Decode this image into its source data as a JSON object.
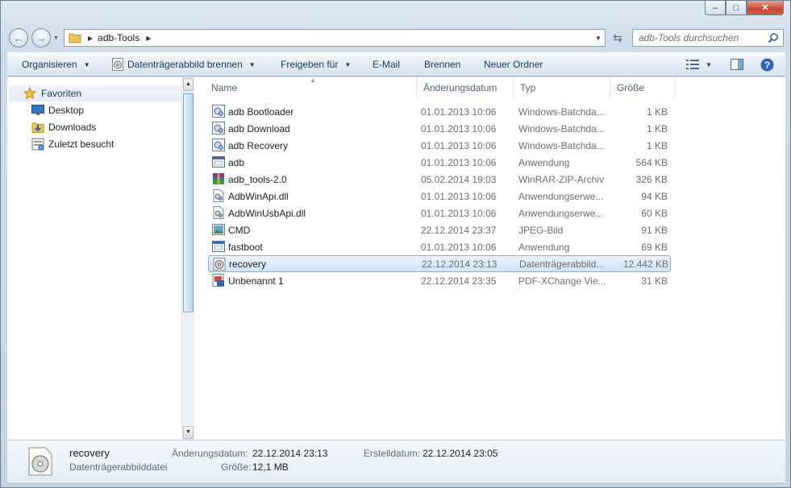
{
  "window": {
    "title_buttons": {
      "minimize": "–",
      "maximize": "□",
      "close": "✕"
    }
  },
  "nav": {
    "back_icon": "←",
    "forward_icon": "→"
  },
  "address": {
    "crumbs": [
      "adb-Tools"
    ]
  },
  "search": {
    "placeholder": "adb-Tools durchsuchen"
  },
  "toolbar": {
    "organize": "Organisieren",
    "burn_image": "Datenträgerabbild brennen",
    "share": "Freigeben für",
    "email": "E-Mail",
    "burn": "Brennen",
    "new_folder": "Neuer Ordner"
  },
  "sidebar": {
    "favorites": "Favoriten",
    "items": [
      {
        "label": "Desktop",
        "icon": "desktop-icon"
      },
      {
        "label": "Downloads",
        "icon": "downloads-folder-icon"
      },
      {
        "label": "Zuletzt besucht",
        "icon": "recent-places-icon"
      }
    ]
  },
  "columns": {
    "name": "Name",
    "date": "Änderungsdatum",
    "type": "Typ",
    "size": "Größe"
  },
  "files": [
    {
      "name": "adb Bootloader",
      "date": "01.01.2013 10:06",
      "type": "Windows-Batchda...",
      "size": "1 KB",
      "icon": "batch-file-icon"
    },
    {
      "name": "adb Download",
      "date": "01.01.2013 10:06",
      "type": "Windows-Batchda...",
      "size": "1 KB",
      "icon": "batch-file-icon"
    },
    {
      "name": "adb Recovery",
      "date": "01.01.2013 10:06",
      "type": "Windows-Batchda...",
      "size": "1 KB",
      "icon": "batch-file-icon"
    },
    {
      "name": "adb",
      "date": "01.01.2013 10:06",
      "type": "Anwendung",
      "size": "564 KB",
      "icon": "application-icon"
    },
    {
      "name": "adb_tools-2.0",
      "date": "05.02.2014 19:03",
      "type": "WinRAR-ZIP-Archiv",
      "size": "326 KB",
      "icon": "winrar-archive-icon"
    },
    {
      "name": "AdbWinApi.dll",
      "date": "01.01.2013 10:06",
      "type": "Anwendungserwe...",
      "size": "94 KB",
      "icon": "dll-file-icon"
    },
    {
      "name": "AdbWinUsbApi.dll",
      "date": "01.01.2013 10:06",
      "type": "Anwendungserwe...",
      "size": "60 KB",
      "icon": "dll-file-icon"
    },
    {
      "name": "CMD",
      "date": "22.12.2014 23:37",
      "type": "JPEG-Bild",
      "size": "91 KB",
      "icon": "jpeg-image-icon"
    },
    {
      "name": "fastboot",
      "date": "01.01.2013 10:06",
      "type": "Anwendung",
      "size": "69 KB",
      "icon": "application-icon"
    },
    {
      "name": "recovery",
      "date": "22.12.2014 23:13",
      "type": "Datenträgerabbild...",
      "size": "12.442 KB",
      "icon": "disc-image-icon",
      "selected": true
    },
    {
      "name": "Unbenannt 1",
      "date": "22.12.2014 23:35",
      "type": "PDF-XChange Vie...",
      "size": "31 KB",
      "icon": "pdf-file-icon"
    }
  ],
  "details": {
    "name": "recovery",
    "type": "Datenträgerabbilddatei",
    "modified_label": "Änderungsdatum:",
    "modified_value": "22.12.2014 23:13",
    "size_label": "Größe:",
    "size_value": "12,1 MB",
    "created_label": "Erstelldatum:",
    "created_value": "22.12.2014 23:05"
  }
}
